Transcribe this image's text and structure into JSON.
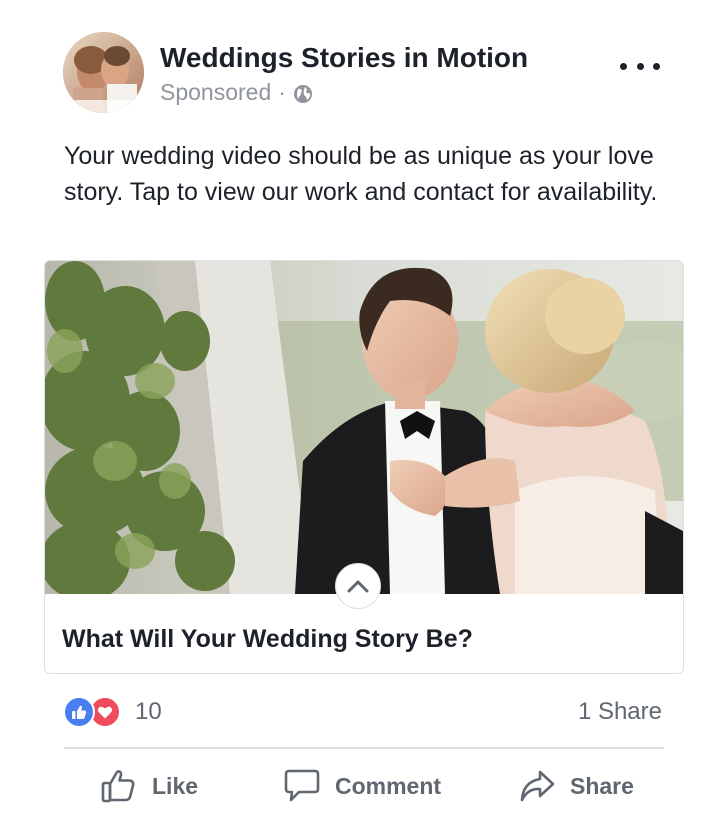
{
  "post": {
    "page_name": "Weddings Stories in Motion",
    "sponsored_label": "Sponsored",
    "separator": "·",
    "privacy_icon": "globe-icon",
    "more_icon": "more-options-icon",
    "text": "Your wedding video should be as unique as your love story. Tap to view our work and contact for availability.",
    "avatar_caption": "wedding stories in motion"
  },
  "link_card": {
    "image_description_icon": "wedding-couple-photo",
    "collapse_icon": "chevron-up-icon",
    "headline": "What Will Your Wedding Story Be?"
  },
  "engagement": {
    "reaction_icons": [
      "like-reaction-icon",
      "love-reaction-icon"
    ],
    "reaction_count": "10",
    "share_count": "1 Share"
  },
  "actions": {
    "like_label": "Like",
    "comment_label": "Comment",
    "share_label": "Share"
  },
  "colors": {
    "like_blue": "#4a7ef0",
    "love_red": "#ee4b5f",
    "secondary_text": "#606770",
    "divider": "#dadde1"
  }
}
